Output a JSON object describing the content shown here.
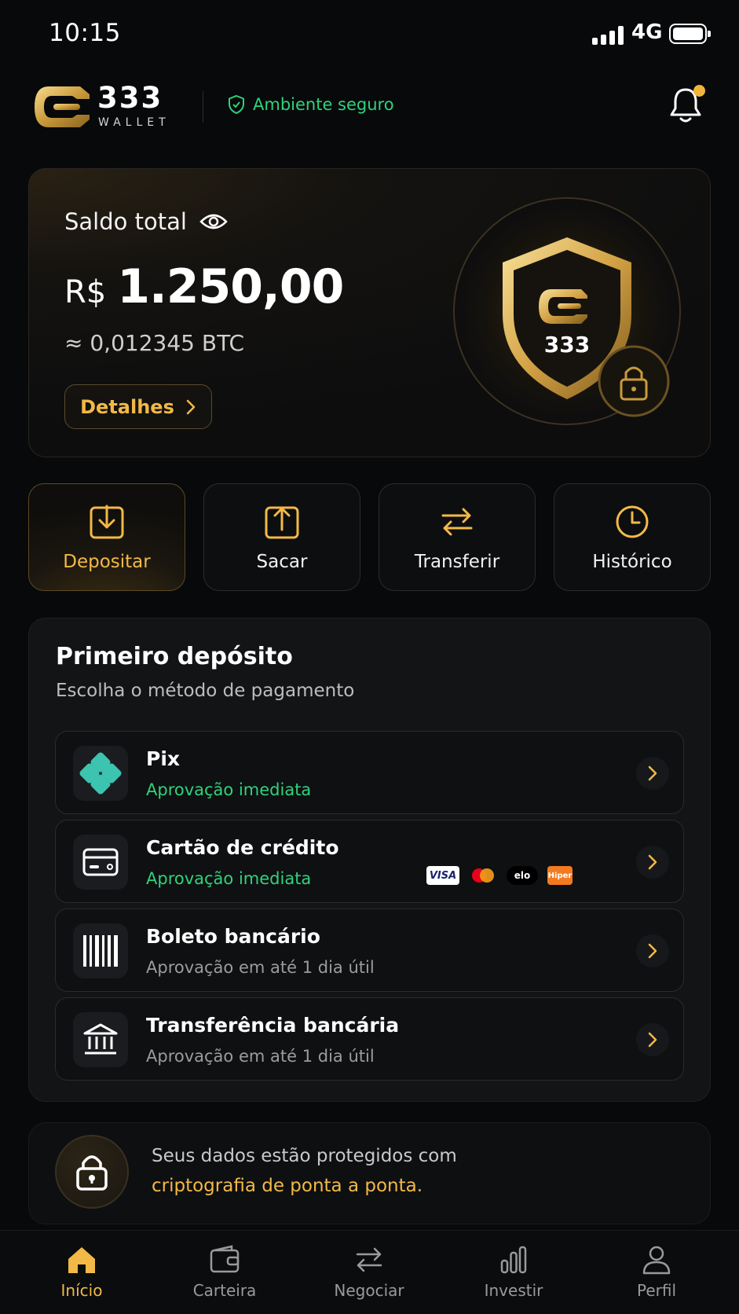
{
  "status": {
    "time": "10:15",
    "network": "4G"
  },
  "header": {
    "logo_text": "333",
    "logo_sub": "WALLET",
    "secure_label": "Ambiente seguro"
  },
  "balance": {
    "label": "Saldo total",
    "currency": "R$",
    "amount": "1.250,00",
    "btc": "≈ 0,012345 BTC",
    "details_button": "Detalhes",
    "shield_text": "333"
  },
  "actions": [
    {
      "label": "Depositar",
      "icon": "download-icon",
      "active": true
    },
    {
      "label": "Sacar",
      "icon": "upload-icon",
      "active": false
    },
    {
      "label": "Transferir",
      "icon": "transfer-icon",
      "active": false
    },
    {
      "label": "Histórico",
      "icon": "clock-icon",
      "active": false
    }
  ],
  "deposit": {
    "title": "Primeiro depósito",
    "subtitle": "Escolha o método de pagamento",
    "methods": [
      {
        "title": "Pix",
        "subtitle": "Aprovação imediata",
        "icon": "pix-icon"
      },
      {
        "title": "Cartão de crédito",
        "subtitle": "Aprovação imediata",
        "icon": "credit-card-icon",
        "brands": [
          "VISA",
          "elo",
          "Hiper"
        ]
      },
      {
        "title": "Boleto bancário",
        "subtitle": "Aprovação em até 1 dia útil",
        "icon": "barcode-icon"
      },
      {
        "title": "Transferência bancária",
        "subtitle": "Aprovação em até 1 dia útil",
        "icon": "bank-icon"
      }
    ]
  },
  "security": {
    "line1": "Seus dados estão protegidos com",
    "line2": "criptografia de ponta a ponta."
  },
  "nav": [
    {
      "label": "Início",
      "icon": "home-icon",
      "active": true
    },
    {
      "label": "Carteira",
      "icon": "wallet-icon",
      "active": false
    },
    {
      "label": "Negociar",
      "icon": "exchange-icon",
      "active": false
    },
    {
      "label": "Investir",
      "icon": "chart-icon",
      "active": false
    },
    {
      "label": "Perfil",
      "icon": "user-icon",
      "active": false
    }
  ],
  "colors": {
    "accent": "#f2b947",
    "success": "#2ed37a",
    "background": "#08090b"
  }
}
